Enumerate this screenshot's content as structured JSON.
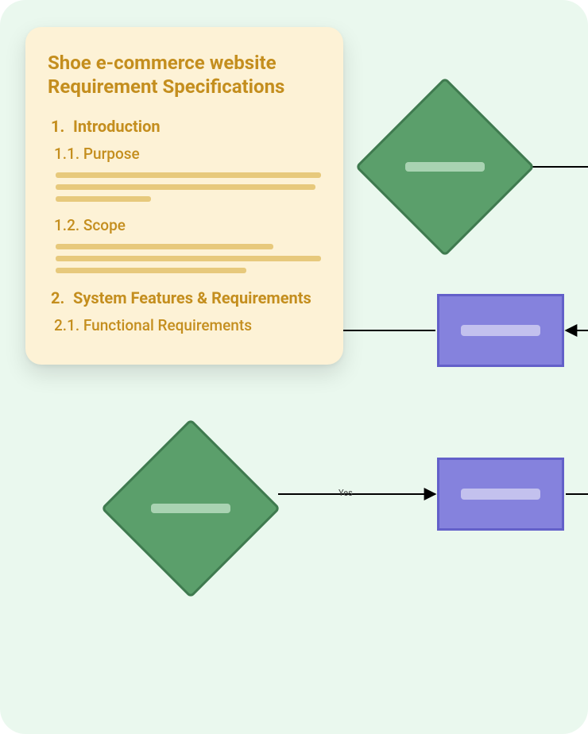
{
  "document": {
    "title": "Shoe e-commerce website Requirement Specifications",
    "sections": [
      {
        "number": "1.",
        "title": "Introduction",
        "subsections": [
          {
            "number": "1.1.",
            "title": "Purpose"
          },
          {
            "number": "1.2.",
            "title": "Scope"
          }
        ]
      },
      {
        "number": "2.",
        "title": "System Features & Requirements",
        "subsections": [
          {
            "number": "2.1.",
            "title": "Functional Requirements"
          }
        ]
      }
    ]
  },
  "flowchart": {
    "edge_labels": {
      "yes": "Yes"
    },
    "shapes": {
      "decision_1": "decision",
      "decision_2": "decision",
      "process_1": "process",
      "process_2": "process"
    }
  },
  "colors": {
    "bg": "#eaf8ee",
    "doc_bg": "#fdf2d6",
    "doc_text": "#c48e1e",
    "decision_fill": "#5b9f6b",
    "process_fill": "#8582dd"
  }
}
